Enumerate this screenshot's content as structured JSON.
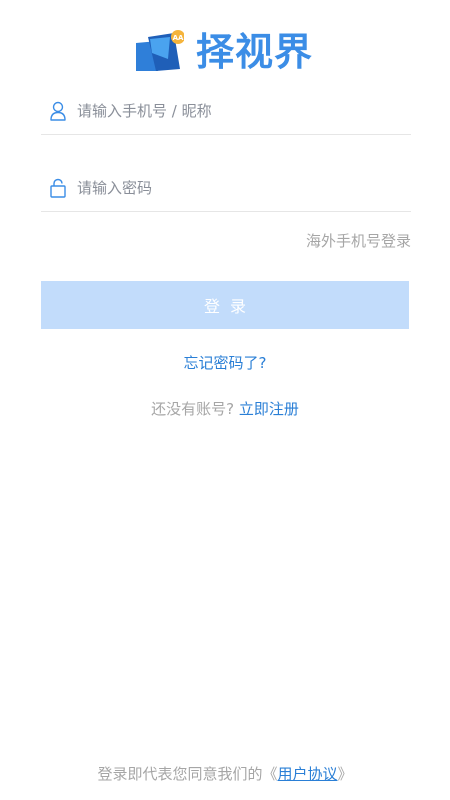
{
  "logo": {
    "text": "择视界",
    "badge": "AA",
    "brand_color": "#3b8de6"
  },
  "phone_field": {
    "icon": "user-icon",
    "placeholder": "请输入手机号 / 昵称",
    "value": ""
  },
  "password_field": {
    "icon": "lock-icon",
    "placeholder": "请输入密码",
    "value": ""
  },
  "overseas_login": "海外手机号登录",
  "login_button": {
    "label": "登录",
    "color": "#c2dcfb"
  },
  "forgot_password": "忘记密码了?",
  "register": {
    "prompt": "还没有账号?",
    "link": "立即注册"
  },
  "agreement": {
    "prefix": "登录即代表您同意我们的《",
    "link": "用户协议",
    "suffix": "》"
  },
  "colors": {
    "link": "#2a7fd6",
    "muted": "#a6a6a6"
  }
}
